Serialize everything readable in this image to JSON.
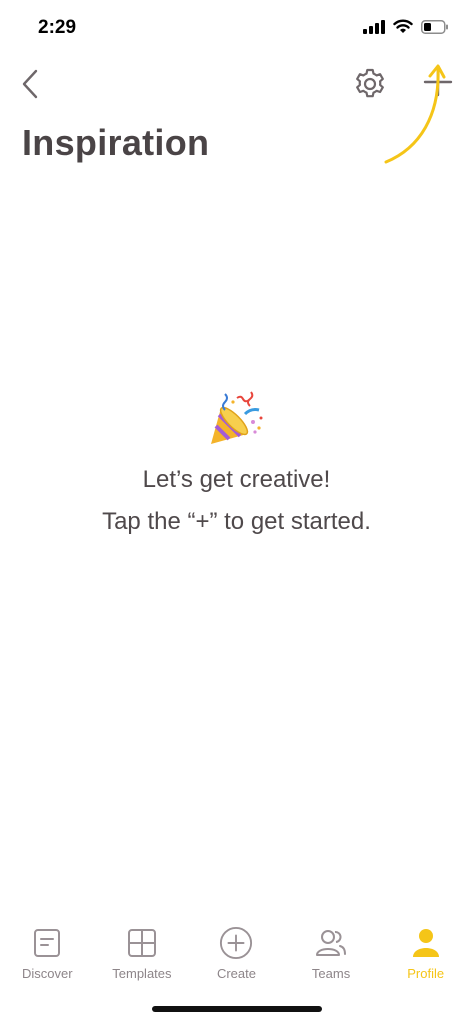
{
  "status_bar": {
    "time": "2:29"
  },
  "header": {
    "title": "Inspiration"
  },
  "empty_state": {
    "line1": "Let’s get creative!",
    "line2": "Tap the “+” to get started."
  },
  "tabs": [
    {
      "label": "Discover",
      "icon": "document-icon"
    },
    {
      "label": "Templates",
      "icon": "grid-icon"
    },
    {
      "label": "Create",
      "icon": "plus-circle-icon"
    },
    {
      "label": "Teams",
      "icon": "people-icon"
    },
    {
      "label": "Profile",
      "icon": "person-icon",
      "active": true
    }
  ],
  "colors": {
    "accent": "#f5c518",
    "text": "#4a4446",
    "muted": "#8d8589"
  }
}
